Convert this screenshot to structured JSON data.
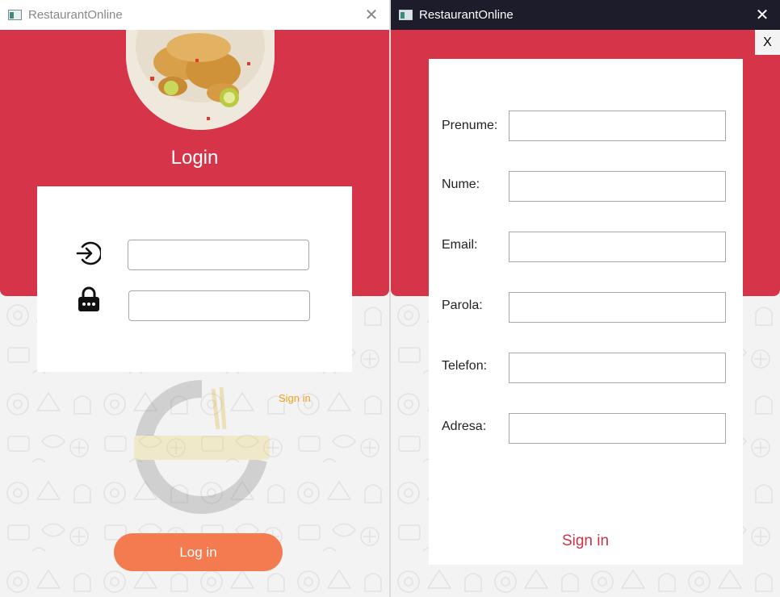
{
  "login_window": {
    "title": "RestaurantOnline",
    "close_glyph": "✕",
    "heading": "Login",
    "username_value": "",
    "password_value": "",
    "signin_link": "Sign in",
    "login_button": "Log in",
    "icons": [
      "login-arrow-icon",
      "padlock-icon",
      "food-plate-image",
      "foodcircle-logo"
    ],
    "colors": {
      "brand_red": "#d63549",
      "button_orange": "#f47a4f",
      "link_orange": "#f0a020"
    }
  },
  "register_window": {
    "title": "RestaurantOnline",
    "close_glyph": "✕",
    "close_button": "X",
    "fields": [
      {
        "label": "Prenume:",
        "value": ""
      },
      {
        "label": "Nume:",
        "value": ""
      },
      {
        "label": "Email:",
        "value": ""
      },
      {
        "label": "Parola:",
        "value": ""
      },
      {
        "label": "Telefon:",
        "value": ""
      },
      {
        "label": "Adresa:",
        "value": ""
      }
    ],
    "signin_link": "Sign in",
    "colors": {
      "titlebar": "#1c1c2a",
      "link_red": "#c8354a"
    }
  }
}
